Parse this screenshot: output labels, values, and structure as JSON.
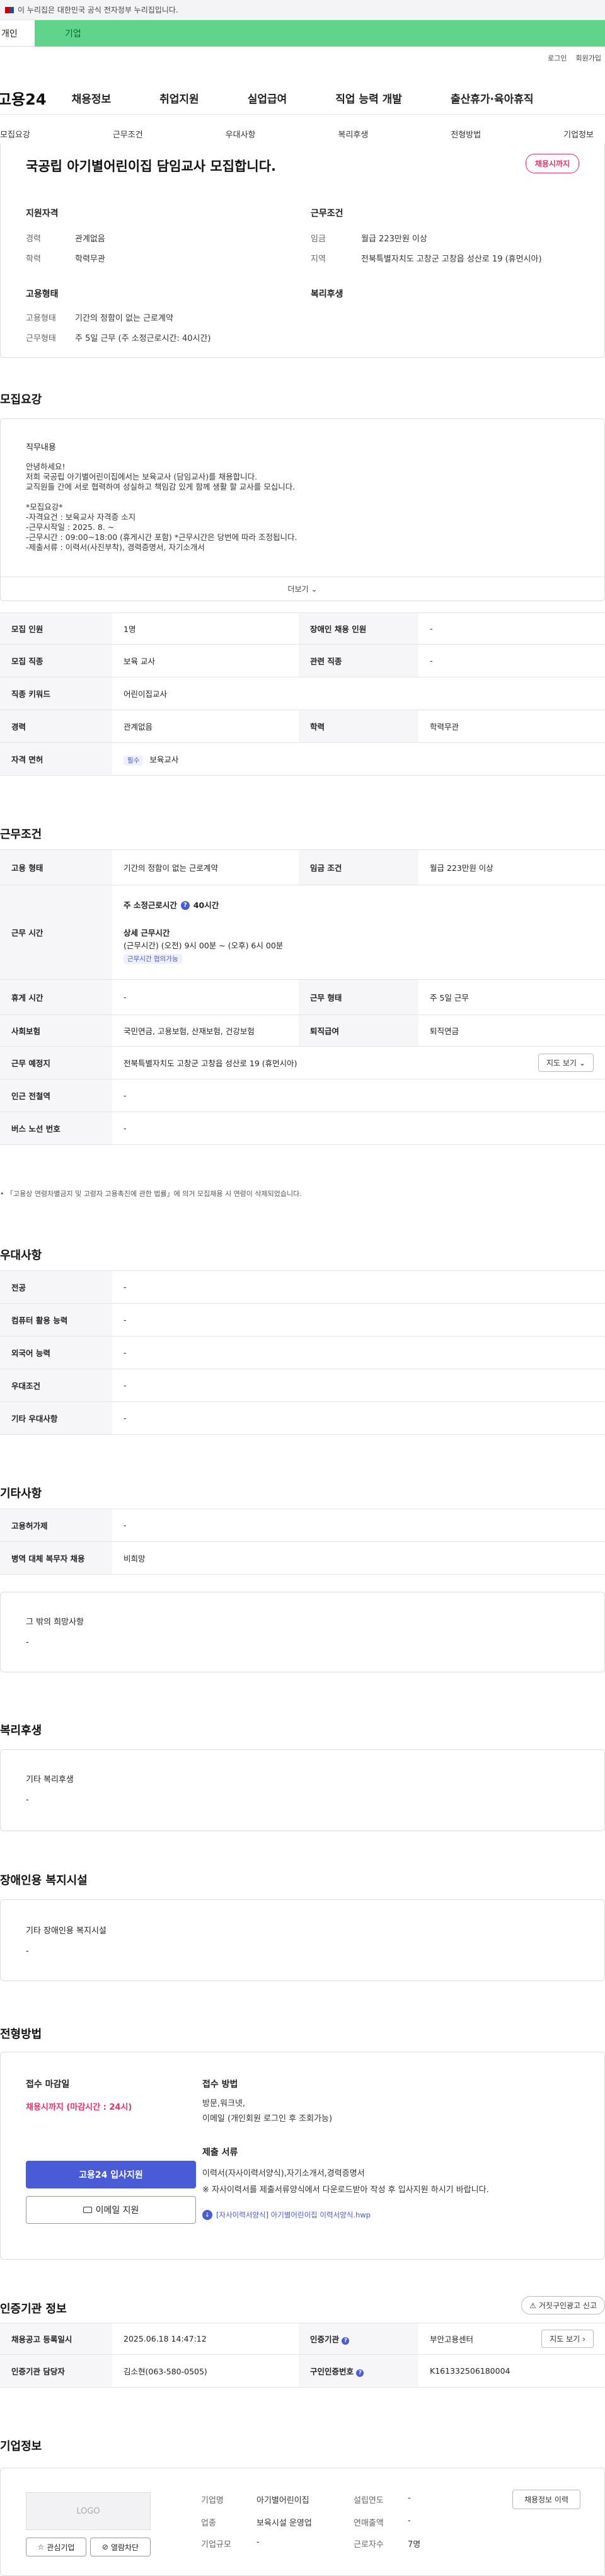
{
  "gov_banner": {
    "text": "이 누리집은 대한민국 공식 전자정부 누리집입니다."
  },
  "top_tabs": {
    "individual": "개인",
    "enterprise": "기업"
  },
  "util_links": {
    "login": "로그인",
    "signup": "회원가입"
  },
  "gnb": {
    "logo": "고용24",
    "menu": [
      "채용정보",
      "취업지원",
      "실업급여",
      "직업 능력 개발",
      "출산휴가·육아휴직"
    ]
  },
  "subnav": [
    "모집요강",
    "근무조건",
    "우대사항",
    "복리후생",
    "전형방법",
    "기업정보"
  ],
  "summary": {
    "title": "국공립 아기별어린이집 담임교사 모집합니다.",
    "badge": "채용시까지",
    "qual_title": "지원자격",
    "career_label": "경력",
    "career_value": "관계없음",
    "edu_label": "학력",
    "edu_value": "학력무관",
    "cond_title": "근무조건",
    "wage_label": "임금",
    "wage_value": "월급 223만원 이상",
    "region_label": "지역",
    "region_value": "전북특별자치도 고창군 고창읍 성산로 19 (휴먼시아)",
    "employ_title": "고용형태",
    "emptype_label": "고용형태",
    "emptype_value": "기간의 정함이 없는 근로계약",
    "worktype_label": "근무형태",
    "worktype_value": "주 5일 근무 (주 소정근로시간: 40시간)",
    "welfare_title": "복리후생"
  },
  "recruit": {
    "section_title": "모집요강",
    "job_title": "직무내용",
    "job_lines": [
      "안녕하세요!",
      "저희 국공립 아기별어린이집에서는 보육교사 (담임교사)를 채용합니다.",
      "교직원들 간에 서로 협력하여 성실하고 책임감 있게 함께 생활 할 교사를 모십니다.",
      "",
      "*모집요강*",
      "-자격요건 : 보육교사 자격증 소지",
      "-근무시작일 : 2025. 8. ~",
      "-근무시간 : 09:00~18:00 (휴게시간 포함) *근무시간은 당번에 따라 조정됩니다.",
      "-제출서류 : 이력서(사진부착), 경력증명서, 자기소개서"
    ],
    "more": "더보기",
    "rows": {
      "headcount_label": "모집 인원",
      "headcount_value": "1명",
      "disabled_label": "장애인 채용 인원",
      "disabled_value": "-",
      "job_label": "모집 직종",
      "job_value": "보육 교사",
      "rel_label": "관련 직종",
      "rel_value": "-",
      "kw_label": "직종 키워드",
      "kw_value": "어린이집교사",
      "career_label": "경력",
      "career_value": "관계없음",
      "edu_label": "학력",
      "edu_value": "학력무관",
      "license_label": "자격 면허",
      "license_chip": "필수",
      "license_value": "보육교사"
    }
  },
  "conditions": {
    "section_title": "근무조건",
    "emptype_label": "고용 형태",
    "emptype_value": "기간의 정함이 없는 근로계약",
    "wage_label": "임금 조건",
    "wage_value": "월급 223만원 이상",
    "hours_label": "근무 시간",
    "hours_weekly": "주 소정근로시간",
    "hours_weekly_value": "40시간",
    "hours_detail_title": "상세 근무시간",
    "hours_detail": "(근무시간) (오전) 9시 00분 ~ (오후) 6시 00분",
    "hours_chip": "근무시간 협의가능",
    "rest_label": "휴게 시간",
    "rest_value": "-",
    "worktype_label": "근무 형태",
    "worktype_value": "주 5일 근무",
    "insurance_label": "사회보험",
    "insurance_value": "국민연금, 고용보험, 산재보험, 건강보험",
    "pension_label": "퇴직급여",
    "pension_value": "퇴직연금",
    "place_label": "근무 예정지",
    "place_value": "전북특별자치도 고창군 고창읍 성산로 19 (휴먼시아)",
    "map_btn": "지도 보기",
    "station_label": "인근 전철역",
    "station_value": "-",
    "bus_label": "버스 노선 번호",
    "bus_value": "-",
    "note": "「고용상 연령차별금지 및 고령자 고용촉진에 관한 법률」에 의거 모집채용 시 연령이 삭제되었습니다."
  },
  "preference": {
    "section_title": "우대사항",
    "rows": [
      {
        "label": "전공",
        "value": "-"
      },
      {
        "label": "컴퓨터 활용 능력",
        "value": "-"
      },
      {
        "label": "외국어 능력",
        "value": "-"
      },
      {
        "label": "우대조건",
        "value": "-"
      },
      {
        "label": "기타 우대사항",
        "value": "-"
      }
    ]
  },
  "etc": {
    "section_title": "기타사항",
    "rows": [
      {
        "label": "고용허가제",
        "value": "-"
      },
      {
        "label": "병역 대체 복무자 채용",
        "value": "비희망"
      }
    ],
    "other_title": "그 밖의 희망사항",
    "other_value": "-"
  },
  "welfare": {
    "section_title": "복리후생",
    "box_title": "기타 복리후생",
    "box_value": "-"
  },
  "disability": {
    "section_title": "장애인용 복지시설",
    "box_title": "기타 장애인용 복지시설",
    "box_value": "-"
  },
  "selection": {
    "section_title": "전형방법",
    "deadline_title": "접수 마감일",
    "deadline_value": "채용시까지 (마감시간 : 24시)",
    "method_title": "접수 방법",
    "method_lines": [
      "방문,워크넷,",
      "이메일 (개인회원 로그인 후 조회가능)"
    ],
    "apply_btn": "고용24 입사지원",
    "email_btn": "이메일 지원",
    "docs_title": "제출 서류",
    "docs_lines": [
      "이력서(자사이력서양식),자기소개서,경력증명서",
      "※ 자사이력서를 제출서류양식에서 다운로드받아 작성 후 입사지원 하시기 바랍니다."
    ],
    "docs_link": "[자사이력서양식] 아기별어린이집 이력서양식.hwp"
  },
  "agency": {
    "section_title": "인증기관 정보",
    "report_btn": "거짓구인광고 신고",
    "reg_label": "채용공고 등록일시",
    "reg_value": "2025.06.18 14:47:12",
    "org_label": "인증기관",
    "org_value": "부안고용센터",
    "manager_label": "인증기관 담당자",
    "manager_value": "김소현(063-580-0505)",
    "no_label": "구인인증번호",
    "no_value": "K161332506180004",
    "map_btn": "지도 보기"
  },
  "company": {
    "section_title": "기업정보",
    "logo": "LOGO",
    "interest_btn": "관심기업",
    "block_btn": "열람차단",
    "history_btn": "채용정보 이력",
    "name_label": "기업명",
    "name_value": "아기별어린이집",
    "founded_label": "설립연도",
    "founded_value": "-",
    "industry_label": "업종",
    "industry_value": "보육시설 운영업",
    "sales_label": "연매출액",
    "sales_value": "-",
    "size_label": "기업규모",
    "size_value": "-",
    "staff_label": "근로자수",
    "staff_value": "7명"
  },
  "colors": {
    "accent": "#4a5bd8",
    "badge": "#e8326b",
    "brand_green": "#5fd48a"
  }
}
